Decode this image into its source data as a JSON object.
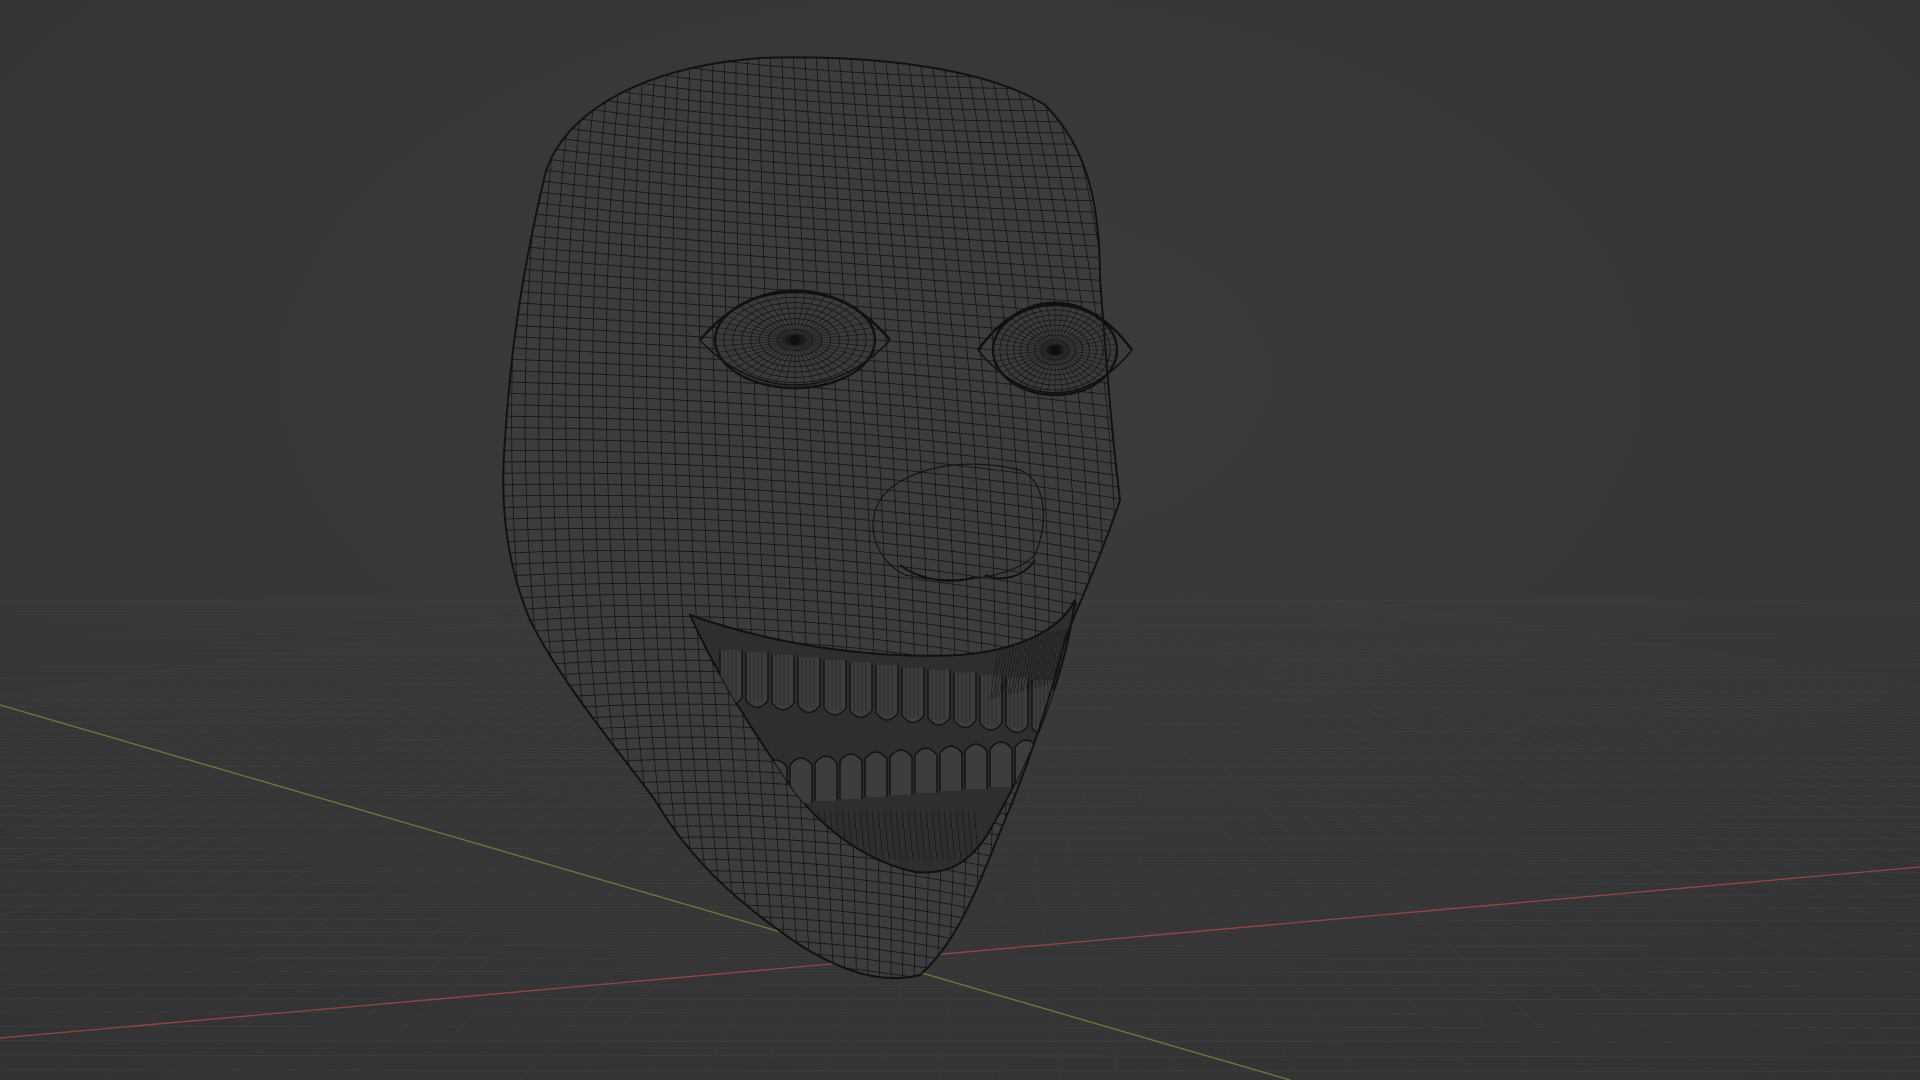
{
  "viewport": {
    "background_color": "#3a3a3a",
    "floor_grid": {
      "visible": true,
      "color": "#454545"
    },
    "axes": {
      "x_axis_color": "#a84848",
      "y_axis_color": "#6e8c3c"
    },
    "object": {
      "shading": "wireframe",
      "wire_color": "#111111",
      "fill_color": "#3c3c3c",
      "features": [
        "face-mesh",
        "eyes",
        "nose",
        "grinning-mouth",
        "teeth"
      ]
    }
  }
}
